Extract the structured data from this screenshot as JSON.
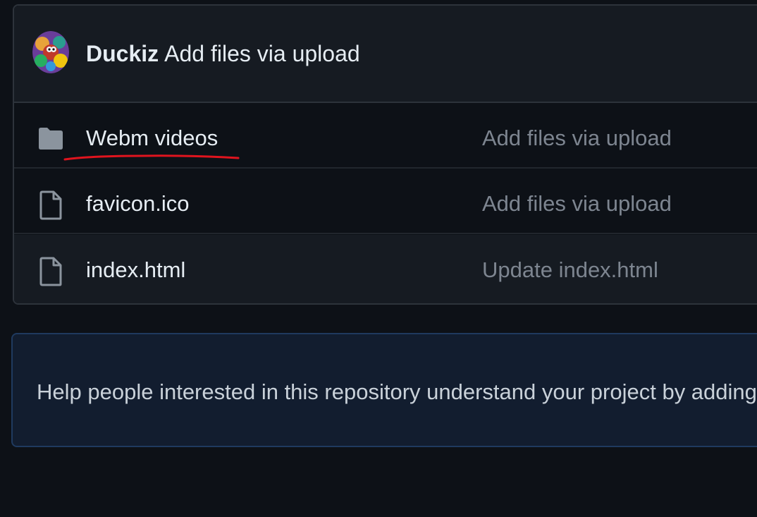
{
  "latest_commit": {
    "author": "Duckiz",
    "message": "Add files via upload",
    "avatar_icon": "user-avatar-icon"
  },
  "files": [
    {
      "name": "Webm videos",
      "type": "folder",
      "icon": "folder-icon",
      "commit_message": "Add files via upload"
    },
    {
      "name": "favicon.ico",
      "type": "file",
      "icon": "file-icon",
      "commit_message": "Add files via upload"
    },
    {
      "name": "index.html",
      "type": "file",
      "icon": "file-icon",
      "commit_message": "Update index.html"
    }
  ],
  "readme_prompt": {
    "text": "Help people interested in this repository understand your project by adding a README."
  },
  "colors": {
    "background": "#0d1117",
    "header_bg": "#161b22",
    "border": "#2d333b",
    "muted_text": "#7d8590",
    "banner_bg": "#121d2f",
    "banner_border": "#1f3a5f",
    "annotation_red": "#e0141e"
  }
}
